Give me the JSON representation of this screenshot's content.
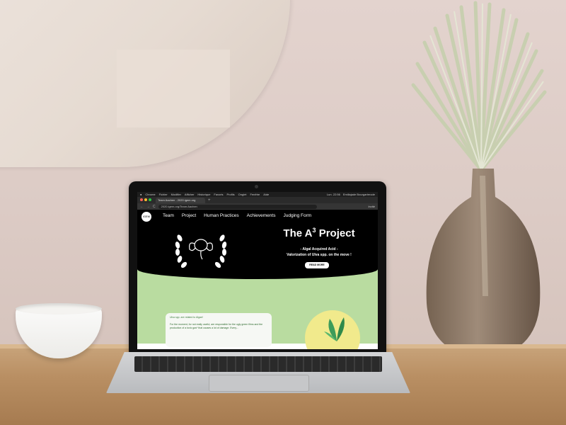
{
  "browser": {
    "menubar": {
      "apple": "",
      "items": [
        "Chrome",
        "Fichier",
        "Modifier",
        "Afficher",
        "Historique",
        "Favoris",
        "Profils",
        "Onglet",
        "Fenêtre",
        "Aide"
      ],
      "right_items": [
        "Lun. 22:56",
        "Emiliajade Bourgarterode"
      ]
    },
    "tab_title": "Team Aachen - 2020.igem.org",
    "new_tab": "+",
    "url": "2020.igem.org/Team:Aachen",
    "profile": "Invité",
    "nav_back": "←",
    "nav_forward": "→",
    "nav_reload": "C"
  },
  "site": {
    "logo_text": "iGEM",
    "nav": [
      "Team",
      "Project",
      "Human Practices",
      "Achievements",
      "Judging Form"
    ],
    "title_main": "The A",
    "title_sup": "3",
    "title_end": " Project",
    "subtitle1": "- Algal Acquired Acid -",
    "subtitle2": "Valorization of Ulva spp. on the move !",
    "read_more": "READ MORE",
    "card_line1": "Ulva spp. are related to Algae!",
    "card_line2": "For the moment, for not really useful, are responsible for the ugly green films and the production of a toxic gas* that causes a lot of damage. Every..."
  },
  "colors": {
    "hero_bg": "#000000",
    "site_green": "#b9dca0",
    "sun_yellow": "#f1ea8c"
  },
  "icons": [
    "laurel-elephant-icon",
    "leaf-icon",
    "apple-icon"
  ]
}
